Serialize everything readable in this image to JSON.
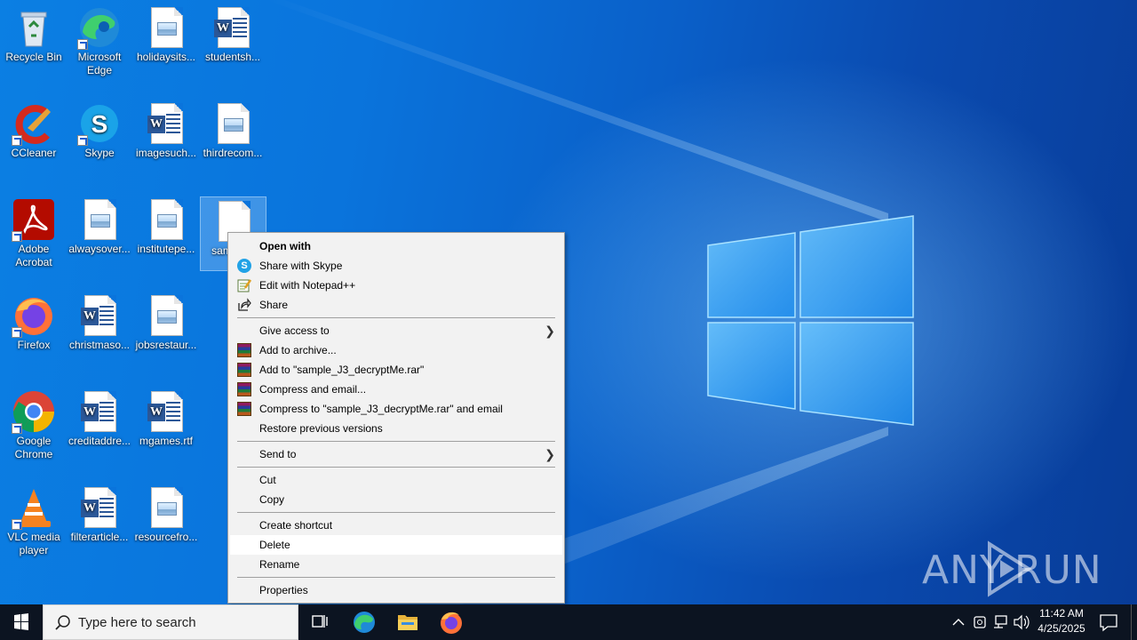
{
  "desktop": {
    "icons": [
      {
        "label": "Recycle Bin",
        "icon": "recycle-bin-icon"
      },
      {
        "label": "Microsoft Edge",
        "icon": "edge-icon"
      },
      {
        "label": "holidaysits...",
        "icon": "image-file-icon"
      },
      {
        "label": "studentsh...",
        "icon": "word-file-icon"
      },
      {
        "label": "CCleaner",
        "icon": "ccleaner-icon"
      },
      {
        "label": "Skype",
        "icon": "skype-icon"
      },
      {
        "label": "imagesuch...",
        "icon": "word-file-icon"
      },
      {
        "label": "thirdrecom...",
        "icon": "image-file-icon"
      },
      {
        "label": "Adobe Acrobat",
        "icon": "acrobat-icon"
      },
      {
        "label": "alwaysover...",
        "icon": "image-file-icon"
      },
      {
        "label": "institutepe...",
        "icon": "image-file-icon"
      },
      {
        "label": "samp cry",
        "icon": "blank-file-icon"
      },
      {
        "label": "Firefox",
        "icon": "firefox-icon"
      },
      {
        "label": "christmaso...",
        "icon": "word-file-icon"
      },
      {
        "label": "jobsrestaur...",
        "icon": "image-file-icon"
      },
      {
        "label": "Google Chrome",
        "icon": "chrome-icon"
      },
      {
        "label": "creditaddre...",
        "icon": "word-file-icon"
      },
      {
        "label": "mgames.rtf",
        "icon": "word-file-icon"
      },
      {
        "label": "VLC media player",
        "icon": "vlc-icon"
      },
      {
        "label": "filterarticle...",
        "icon": "word-file-icon"
      },
      {
        "label": "resourcefro...",
        "icon": "image-file-icon"
      }
    ]
  },
  "context_menu": {
    "items": [
      {
        "label": "Open with",
        "icon": ""
      },
      {
        "label": "Share with Skype",
        "icon": "skype-icon"
      },
      {
        "label": "Edit with Notepad++",
        "icon": "notepadpp-icon"
      },
      {
        "label": "Share",
        "icon": "share-icon"
      },
      {
        "label": "Give access to",
        "icon": ""
      },
      {
        "label": "Add to archive...",
        "icon": "winrar-icon"
      },
      {
        "label": "Add to \"sample_J3_decryptMe.rar\"",
        "icon": "winrar-icon"
      },
      {
        "label": "Compress and email...",
        "icon": "winrar-icon"
      },
      {
        "label": "Compress to \"sample_J3_decryptMe.rar\" and email",
        "icon": "winrar-icon"
      },
      {
        "label": "Restore previous versions",
        "icon": ""
      },
      {
        "label": "Send to",
        "icon": ""
      },
      {
        "label": "Cut",
        "icon": ""
      },
      {
        "label": "Copy",
        "icon": ""
      },
      {
        "label": "Create shortcut",
        "icon": ""
      },
      {
        "label": "Delete",
        "icon": ""
      },
      {
        "label": "Rename",
        "icon": ""
      },
      {
        "label": "Properties",
        "icon": ""
      }
    ],
    "highlighted": "Delete"
  },
  "watermark": {
    "left": "ANY",
    "right": "RUN"
  },
  "taskbar": {
    "search_placeholder": "Type here to search",
    "pinned": [
      "task-view-icon",
      "edge-icon",
      "file-explorer-icon",
      "firefox-icon"
    ],
    "tray": [
      "chevron-up-icon",
      "device-icon",
      "network-icon",
      "volume-icon"
    ],
    "clock": {
      "time": "11:42 AM",
      "date": "4/25/2025"
    }
  },
  "colors": {
    "accent": "#0a74dc",
    "taskbar": "#0c1421",
    "menu_bg": "#f2f2f2"
  }
}
